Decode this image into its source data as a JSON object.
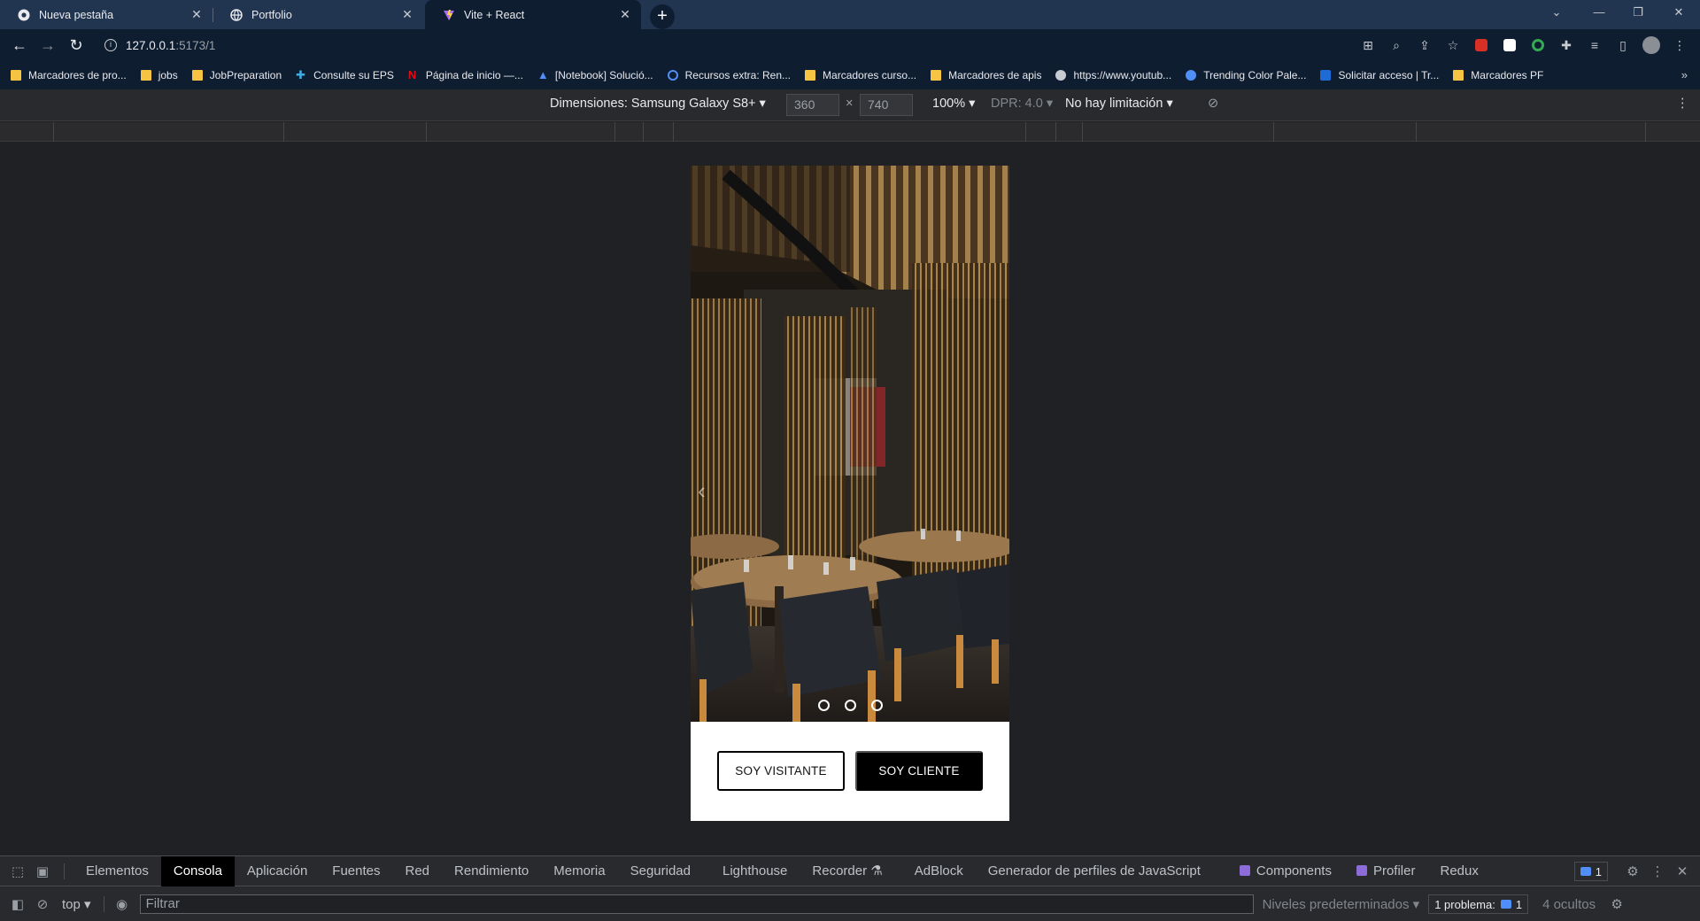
{
  "browser": {
    "tabs": [
      {
        "title": "Nueva pestaña",
        "active": false
      },
      {
        "title": "Portfolio",
        "active": false
      },
      {
        "title": "Vite + React",
        "active": true
      }
    ],
    "address": {
      "host": "127.0.0.1",
      "path": ":5173/1"
    },
    "bookmarks": [
      {
        "label": "Marcadores de pro...",
        "icon": "folder"
      },
      {
        "label": "jobs",
        "icon": "folder"
      },
      {
        "label": "JobPreparation",
        "icon": "folder"
      },
      {
        "label": "Consulte su EPS",
        "icon": "plus-icon"
      },
      {
        "label": "Página de inicio —...",
        "icon": "netflix-icon"
      },
      {
        "label": "[Notebook] Solució...",
        "icon": "a-icon"
      },
      {
        "label": "Recursos extra: Ren...",
        "icon": "circle-icon"
      },
      {
        "label": "Marcadores curso...",
        "icon": "folder"
      },
      {
        "label": "Marcadores de apis",
        "icon": "folder"
      },
      {
        "label": "https://www.youtub...",
        "icon": "globe-icon"
      },
      {
        "label": "Trending Color Pale...",
        "icon": "palette-icon"
      },
      {
        "label": "Solicitar acceso | Tr...",
        "icon": "trello-icon"
      },
      {
        "label": "Marcadores PF",
        "icon": "folder"
      }
    ]
  },
  "device_toolbar": {
    "dimensions_label": "Dimensiones: Samsung Galaxy S8+",
    "width": "360",
    "times": "×",
    "height": "740",
    "zoom": "100%",
    "dpr": "DPR: 4.0",
    "throttle": "No hay limitación"
  },
  "app": {
    "carousel": {
      "slide_count": 3,
      "prev_icon": "chevron-left-icon"
    },
    "buttons": {
      "visitor": "SOY VISITANTE",
      "client": "SOY CLIENTE"
    }
  },
  "devtools": {
    "tabs": [
      "Elementos",
      "Consola",
      "Aplicación",
      "Fuentes",
      "Red",
      "Rendimiento",
      "Memoria",
      "Seguridad",
      "Lighthouse",
      "Recorder",
      "AdBlock",
      "Generador de perfiles de JavaScript",
      "Components",
      "Profiler",
      "Redux"
    ],
    "active_tab": "Consola",
    "issues_badge": "1",
    "context": "top",
    "filter_placeholder": "Filtrar",
    "levels": "Niveles predeterminados",
    "problems": "1 problema:",
    "problems_count": "1",
    "hidden": "4 ocultos"
  },
  "colors": {
    "tabstrip": "#213551",
    "toolbar": "#0f1d31",
    "accent": "#4f8ff7"
  }
}
